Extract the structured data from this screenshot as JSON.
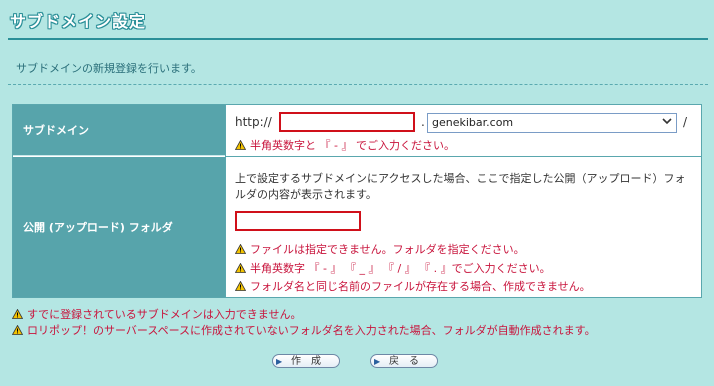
{
  "page_title": "サブドメイン設定",
  "description": "サブドメインの新規登録を行います。",
  "subdomain_row": {
    "label": "サブドメイン",
    "protocol": "http://",
    "dot": ".",
    "subdomain_value": "",
    "domain_selected": "genekibar.com",
    "trailing_slash": "/",
    "warning": "半角英数字と 『 - 』 でご入力ください。"
  },
  "folder_row": {
    "label": "公開 (アップロード) フォルダ",
    "info": "上で設定するサブドメインにアクセスした場合、ここで指定した公開（アップロード）フォルダの内容が表示されます。",
    "folder_value": "",
    "warnings": [
      "ファイルは指定できません。フォルダを指定ください。",
      "半角英数字 『 - 』 『 _ 』 『 / 』 『 . 』でご入力ください。",
      "フォルダ名と同じ名前のファイルが存在する場合、作成できません。"
    ]
  },
  "notes": [
    "すでに登録されているサブドメインは入力できません。",
    "ロリポップ！のサーバースペースに作成されていないフォルダ名を入力された場合、フォルダが自動作成されます。"
  ],
  "buttons": {
    "create": "作　成",
    "back": "戻　る"
  },
  "colors": {
    "background": "#b4e6e3",
    "label_bg": "#57a4ab",
    "accent": "#2a8f98",
    "warning_text": "#c8143c",
    "input_highlight": "#d0101a"
  }
}
